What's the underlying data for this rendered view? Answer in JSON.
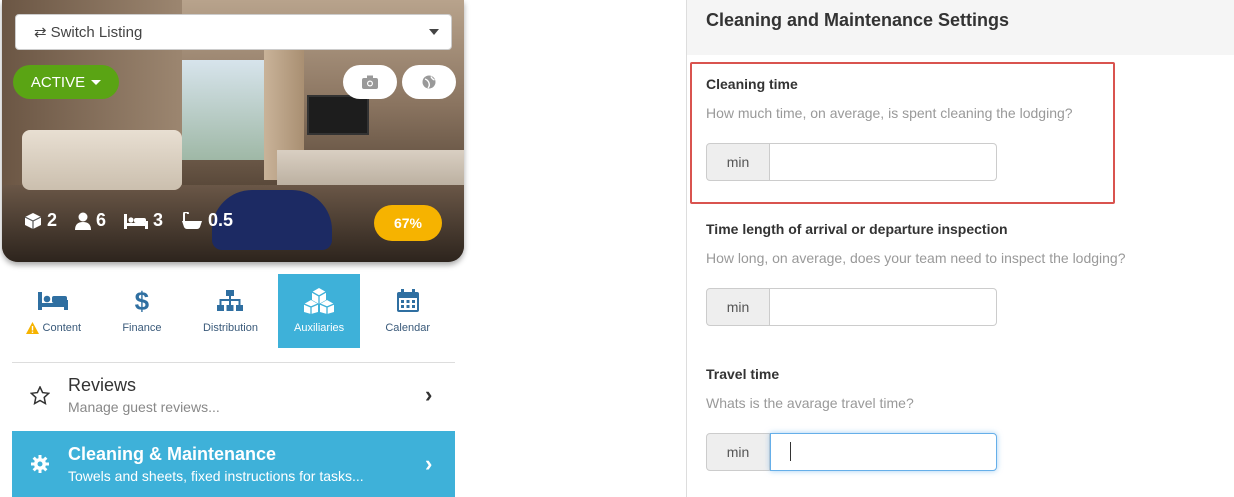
{
  "listing": {
    "switch_label": "Switch Listing",
    "status": "ACTIVE",
    "stats": {
      "rooms": "2",
      "guests": "6",
      "beds": "3",
      "baths": "0.5"
    },
    "completion": "67%"
  },
  "tabs": [
    {
      "label": "Content",
      "icon": "bed-icon",
      "warning": true
    },
    {
      "label": "Finance",
      "icon": "dollar-icon"
    },
    {
      "label": "Distribution",
      "icon": "sitemap-icon"
    },
    {
      "label": "Auxiliaries",
      "icon": "cubes-icon",
      "active": true
    },
    {
      "label": "Calendar",
      "icon": "calendar-icon"
    }
  ],
  "menu": [
    {
      "title": "Reviews",
      "subtitle": "Manage guest reviews...",
      "icon": "star-icon"
    },
    {
      "title": "Cleaning & Maintenance",
      "subtitle": "Towels and sheets, fixed instructions for tasks...",
      "icon": "gear-icon",
      "selected": true
    }
  ],
  "panel": {
    "title": "Cleaning and Maintenance Settings",
    "fields": [
      {
        "label": "Cleaning time",
        "description": "How much time, on average, is spent cleaning the lodging?",
        "addon": "min",
        "value": ""
      },
      {
        "label": "Time length of arrival or departure inspection",
        "description": "How long, on average, does your team need to inspect the lodging?",
        "addon": "min",
        "value": ""
      },
      {
        "label": "Travel time",
        "description": "Whats is the avarage travel time?",
        "addon": "min",
        "value": ""
      }
    ]
  },
  "colors": {
    "accent": "#3eb1d9",
    "active": "#5aa414",
    "badge": "#f6b300",
    "highlight": "#d9534f"
  }
}
